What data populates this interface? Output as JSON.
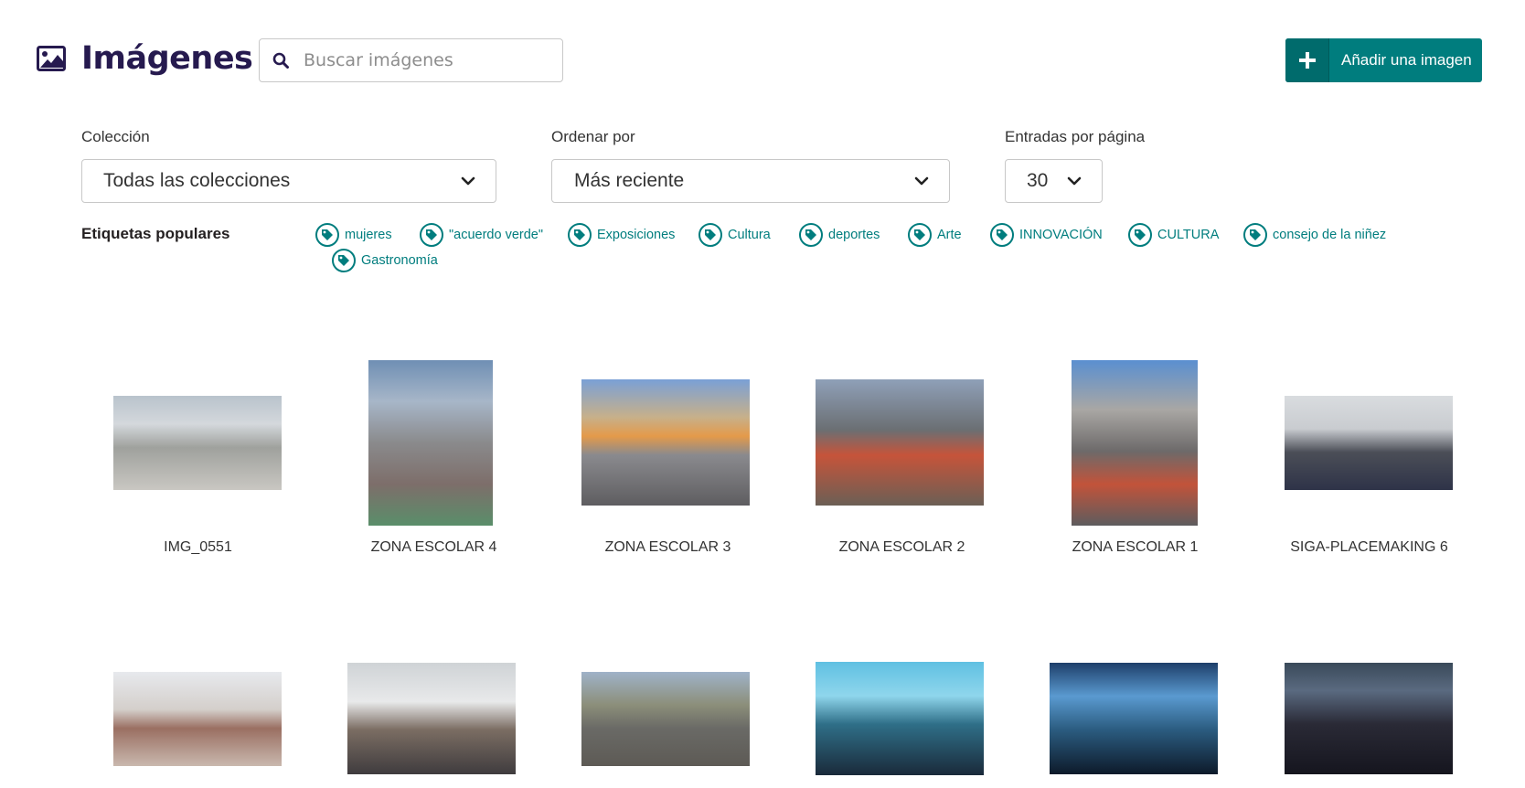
{
  "header": {
    "title": "Imágenes",
    "search_placeholder": "Buscar imágenes",
    "add_button_label": "Añadir una imagen"
  },
  "filters": {
    "collection": {
      "label": "Colección",
      "value": "Todas las colecciones"
    },
    "order": {
      "label": "Ordenar por",
      "value": "Más reciente"
    },
    "per_page": {
      "label": "Entradas por página",
      "value": "30"
    }
  },
  "tags": {
    "heading": "Etiquetas populares",
    "items": [
      "mujeres",
      "\"acuerdo verde\"",
      "Exposiciones",
      "Cultura",
      "deportes",
      "Arte",
      "INNOVACIÓN",
      "CULTURA",
      "consejo de la niñez",
      "Gastronomía"
    ]
  },
  "images": [
    {
      "title": "IMG_0551"
    },
    {
      "title": "ZONA ESCOLAR 4"
    },
    {
      "title": "ZONA ESCOLAR 3"
    },
    {
      "title": "ZONA ESCOLAR 2"
    },
    {
      "title": "ZONA ESCOLAR 1"
    },
    {
      "title": "SIGA-PLACEMAKING 6"
    },
    {
      "title": ""
    },
    {
      "title": ""
    },
    {
      "title": ""
    },
    {
      "title": ""
    },
    {
      "title": ""
    },
    {
      "title": ""
    }
  ],
  "colors": {
    "accent": "#007d7e",
    "title": "#261a4f"
  }
}
